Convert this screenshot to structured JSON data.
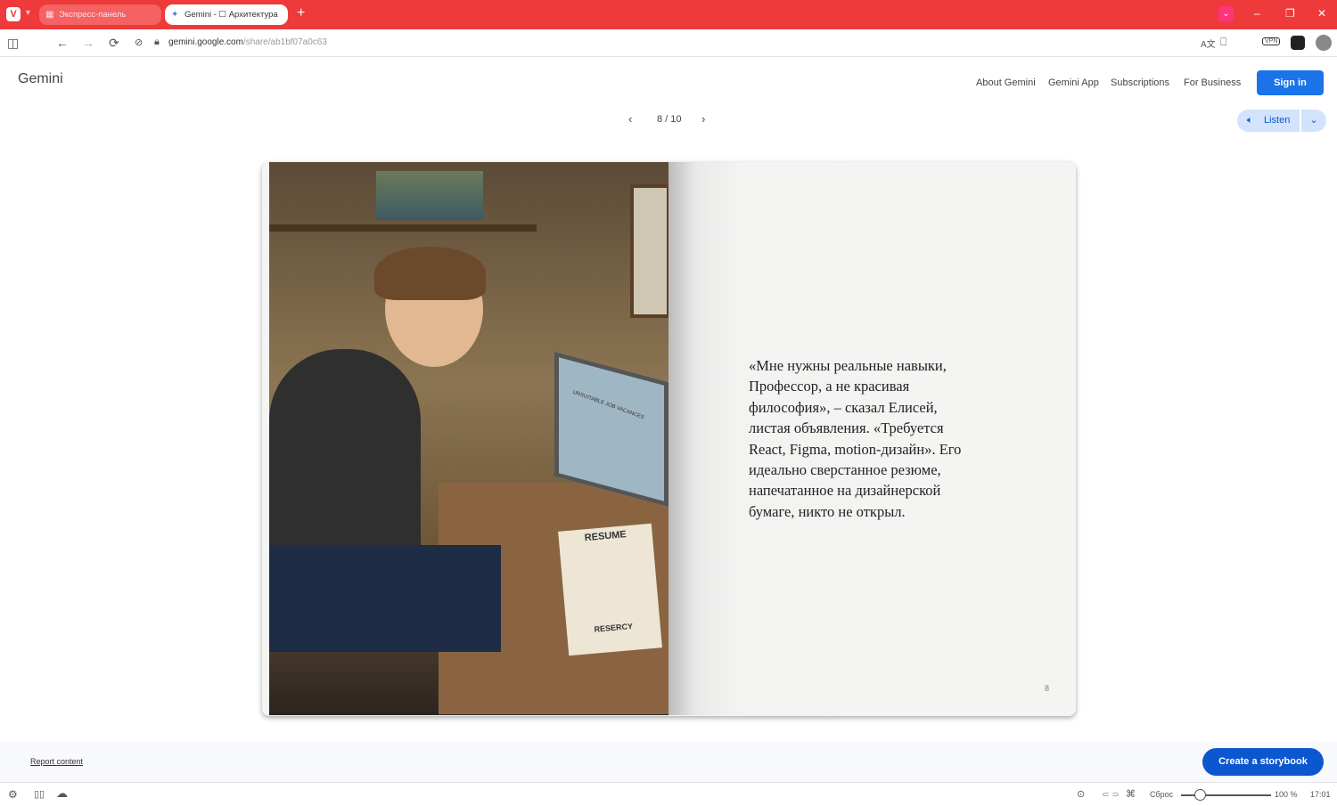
{
  "browser": {
    "tabs": [
      {
        "label": "Экспресс-панель",
        "icon": "grid-icon"
      },
      {
        "label": "Gemini - ☐ Архитектура",
        "icon": "gemini-sparkle-icon"
      }
    ],
    "url_host": "gemini.google.com",
    "url_path": "/share/ab1bf07a0c63",
    "vpn_label": "VPN"
  },
  "header": {
    "logo": "Gemini",
    "nav": [
      "About Gemini",
      "Gemini App",
      "Subscriptions",
      "For Business"
    ],
    "sign_in": "Sign in"
  },
  "pager": {
    "current": "8 / 10"
  },
  "listen": {
    "label": "Listen"
  },
  "book": {
    "text": "«Мне нужны реальные навыки, Профессор, а не красивая философия», – сказал Елисей, листая объявления. «Требуется React, Figma, motion-дизайн». Его идеально сверстанное резюме, напечатанное на дизайнерской бумаге, никто не открыл.",
    "page_number": "8",
    "illustration_texts": [
      "UNSUITABLE JOB VACANCES",
      "RESUME",
      "RESERCY"
    ]
  },
  "footer": {
    "report": "Report content",
    "create": "Create a storybook"
  },
  "status": {
    "reset": "Сброс",
    "zoom": "100 %",
    "time": "17:01",
    "zoom_fraction": 0.15
  }
}
